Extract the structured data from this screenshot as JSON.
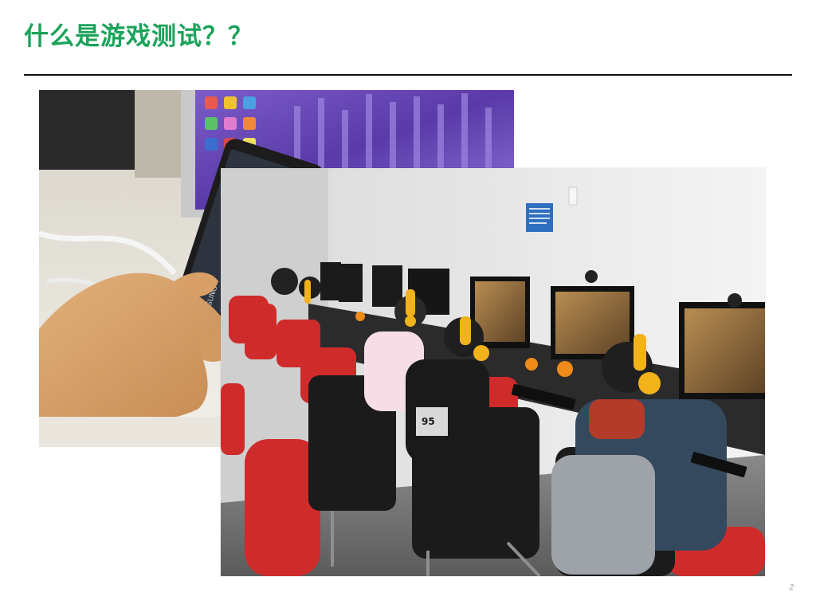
{
  "slide": {
    "title": "什么是游戏测试？？",
    "page_number": "2"
  },
  "images": [
    {
      "name": "smartphone-in-hand-photo",
      "subject": "hand holding smartphone in front of monitor with purple lavender wallpaper",
      "brand_text": "SAMSUNG"
    },
    {
      "name": "internet-cafe-photo",
      "subject": "children with yellow headsets playing PC games in an internet cafe",
      "jersey_text": "95"
    }
  ],
  "colors": {
    "title": "#1aa35a",
    "rule": "#111111",
    "page_number": "#9a9a9a"
  }
}
